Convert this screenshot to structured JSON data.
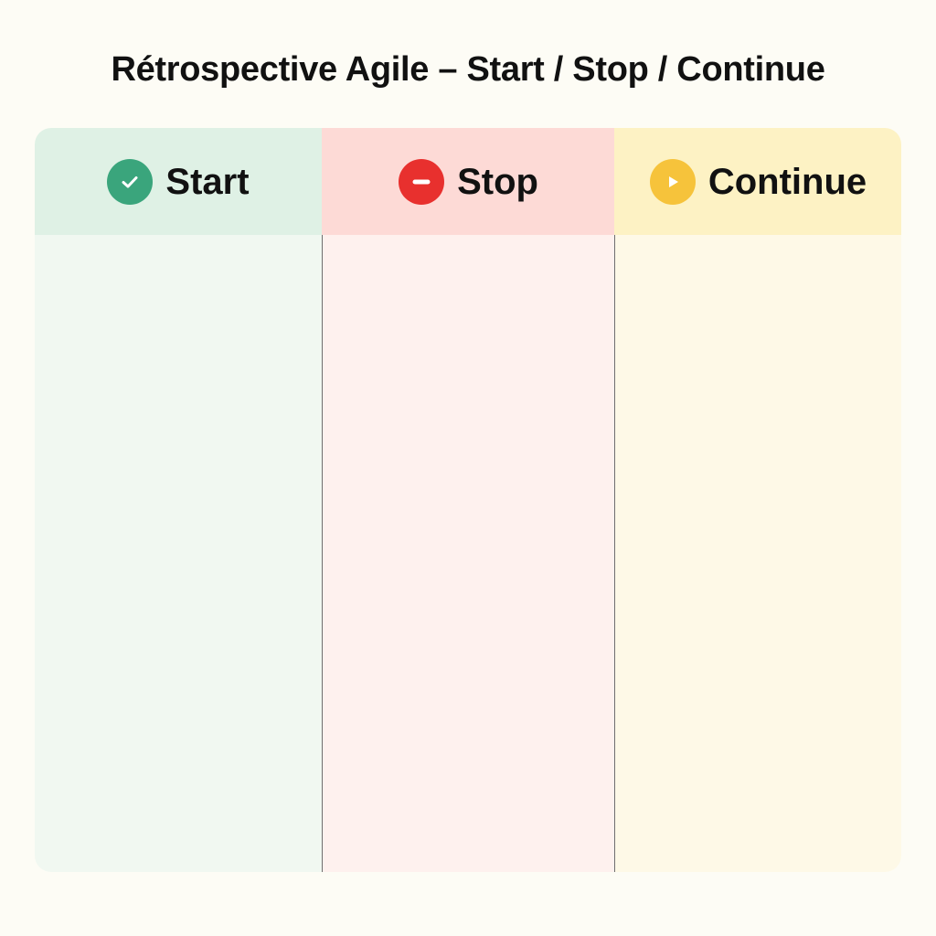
{
  "title": "Rétrospective Agile – Start / Stop / Continue",
  "columns": [
    {
      "label": "Start",
      "icon": "check-circle-icon",
      "accent": "#3aa57c",
      "header_bg": "#dff1e5",
      "body_bg": "#f1f8f1"
    },
    {
      "label": "Stop",
      "icon": "minus-circle-icon",
      "accent": "#e8302e",
      "header_bg": "#fddad6",
      "body_bg": "#fef1ee"
    },
    {
      "label": "Continue",
      "icon": "play-circle-icon",
      "accent": "#f6c33b",
      "header_bg": "#fdf2c4",
      "body_bg": "#fef9e7"
    }
  ]
}
